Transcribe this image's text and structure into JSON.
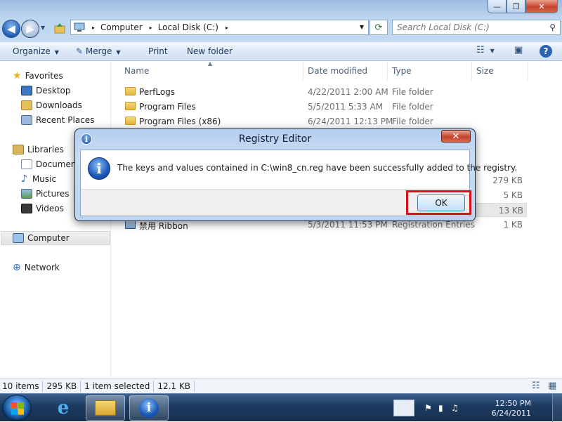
{
  "window": {
    "controls": {
      "minimize": "—",
      "maximize": "❐",
      "close": "✕"
    }
  },
  "address": {
    "root_arrow": "▸",
    "segments": [
      "Computer",
      "Local Disk (C:)"
    ],
    "search_placeholder": "Search Local Disk (C:)"
  },
  "toolbar": {
    "organize": "Organize",
    "merge": "Merge",
    "print": "Print",
    "new_folder": "New folder"
  },
  "nav": {
    "favorites": "Favorites",
    "desktop": "Desktop",
    "downloads": "Downloads",
    "recent_places": "Recent Places",
    "libraries": "Libraries",
    "documents": "Document",
    "music": "Music",
    "pictures": "Pictures",
    "videos": "Videos",
    "computer": "Computer",
    "network": "Network"
  },
  "columns": {
    "name": "Name",
    "date": "Date modified",
    "type": "Type",
    "size": "Size"
  },
  "files": [
    {
      "name": "PerfLogs",
      "date": "4/22/2011 2:00 AM",
      "type": "File folder",
      "size": ""
    },
    {
      "name": "Program Files",
      "date": "5/5/2011 5:33 AM",
      "type": "File folder",
      "size": ""
    },
    {
      "name": "Program Files (x86)",
      "date": "6/24/2011 12:13 PM",
      "type": "File folder",
      "size": ""
    },
    {
      "name": "",
      "date": "",
      "type": "",
      "size": "279 KB"
    },
    {
      "name": "",
      "date": "",
      "type": "",
      "size": "5 KB"
    },
    {
      "name": "",
      "date": "",
      "type": "",
      "size": "13 KB"
    },
    {
      "name": "禁用 Ribbon",
      "date": "5/3/2011 11:53 PM",
      "type": "Registration Entries",
      "size": "1 KB"
    }
  ],
  "status": {
    "items": "10 items",
    "total": "295 KB",
    "selected": "1 item selected",
    "selected_size": "12.1 KB"
  },
  "dialog": {
    "title": "Registry Editor",
    "message": "The keys and values contained in C:\\win8_cn.reg have been successfully added to the registry.",
    "ok": "OK",
    "close": "✕"
  },
  "taskbar": {
    "time": "12:50 PM",
    "date": "6/24/2011"
  }
}
